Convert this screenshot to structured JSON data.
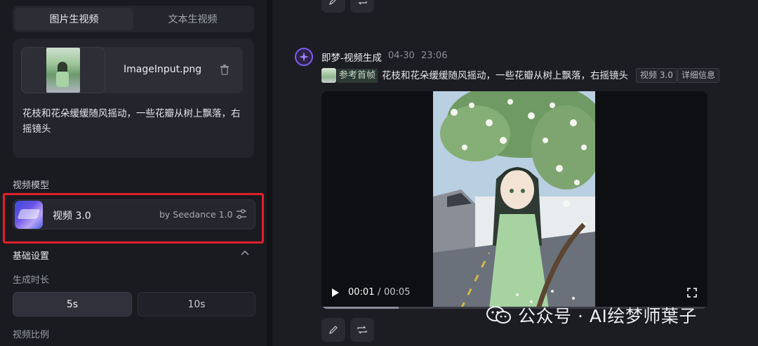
{
  "tabs": [
    {
      "label": "图片生视频",
      "active": true
    },
    {
      "label": "文本生视频",
      "active": false
    }
  ],
  "upload": {
    "file_name": "ImageInput.png",
    "prompt": "花枝和花朵缓缓随风摇动，一些花瓣从树上飘落，右摇镜头"
  },
  "model": {
    "section_label": "视频模型",
    "name": "视频 3.0",
    "by": "by Seedance 1.0",
    "thumb_icon": "model-thumbnail",
    "settings_icon": "sliders-icon"
  },
  "basic_settings": {
    "label": "基础设置",
    "collapse_icon": "chevron-up-icon",
    "duration_label": "生成时长",
    "durations": [
      {
        "label": "5s",
        "selected": true
      },
      {
        "label": "10s",
        "selected": false
      }
    ],
    "ratio_label": "视频比例"
  },
  "message": {
    "author": "即梦-视频生成",
    "date": "04-30",
    "time": "23:06",
    "ref_label": "参考首帧",
    "prompt": "花枝和花朵缓缓随风摇动，一些花瓣从树上飘落，右摇镜头",
    "tags": [
      "视频 3.0",
      "详细信息"
    ]
  },
  "player": {
    "current": "00:01",
    "separator": "/",
    "total": "00:05",
    "progress": 0.2
  },
  "actions": {
    "edit_icon": "pencil-icon",
    "regenerate_icon": "repeat-icon"
  },
  "watermark": {
    "text": "公众号 · AI绘梦师葉子"
  },
  "colors": {
    "accent_red": "#e0202a",
    "avatar_purple": "#7a5cf0",
    "panel_bg": "#1a1b21"
  }
}
